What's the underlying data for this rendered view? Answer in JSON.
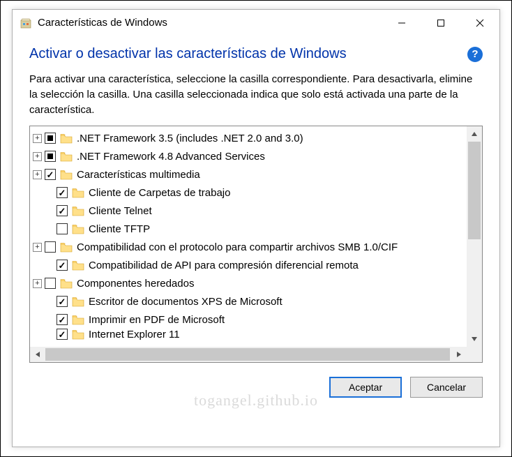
{
  "window": {
    "title": "Características de Windows"
  },
  "heading": "Activar o desactivar las características de Windows",
  "help_symbol": "?",
  "description": "Para activar una característica, seleccione la casilla correspondiente. Para desactivarla, elimine la selección la casilla. Una casilla seleccionada indica que solo está activada una parte de la característica.",
  "tree": [
    {
      "expand": "+",
      "state": "partial",
      "indent": 0,
      "label": ".NET Framework 3.5 (includes .NET 2.0 and 3.0)"
    },
    {
      "expand": "+",
      "state": "partial",
      "indent": 0,
      "label": ".NET Framework 4.8 Advanced Services"
    },
    {
      "expand": "+",
      "state": "checked",
      "indent": 0,
      "label": "Características multimedia"
    },
    {
      "expand": "",
      "state": "checked",
      "indent": 1,
      "label": "Cliente de Carpetas de trabajo"
    },
    {
      "expand": "",
      "state": "checked",
      "indent": 1,
      "label": "Cliente Telnet"
    },
    {
      "expand": "",
      "state": "unchecked",
      "indent": 1,
      "label": "Cliente TFTP"
    },
    {
      "expand": "+",
      "state": "unchecked",
      "indent": 0,
      "label": "Compatibilidad con el protocolo para compartir archivos SMB 1.0/CIF"
    },
    {
      "expand": "",
      "state": "checked",
      "indent": 1,
      "label": "Compatibilidad de API para compresión diferencial remota"
    },
    {
      "expand": "+",
      "state": "unchecked",
      "indent": 0,
      "label": "Componentes heredados"
    },
    {
      "expand": "",
      "state": "checked",
      "indent": 1,
      "label": "Escritor de documentos XPS de Microsoft"
    },
    {
      "expand": "",
      "state": "checked",
      "indent": 1,
      "label": "Imprimir en PDF de Microsoft"
    },
    {
      "expand": "",
      "state": "checked",
      "indent": 1,
      "label": "Internet Explorer 11",
      "cut": true
    }
  ],
  "buttons": {
    "ok": "Aceptar",
    "cancel": "Cancelar"
  },
  "watermark": "togangel.github.io"
}
